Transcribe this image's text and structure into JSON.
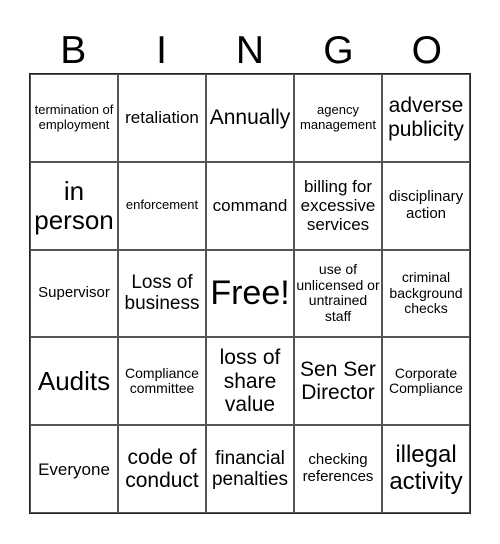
{
  "header": {
    "letters": [
      "B",
      "I",
      "N",
      "G",
      "O"
    ]
  },
  "cells": [
    [
      "termination of employment",
      "retaliation",
      "Annually",
      "agency management",
      "adverse publicity"
    ],
    [
      "in person",
      "enforcement",
      "command",
      "billing for excessive services",
      "disciplinary action"
    ],
    [
      "Supervisor",
      "Loss of business",
      "Free!",
      "use of unlicensed or untrained staff",
      "criminal background checks"
    ],
    [
      "Audits",
      "Compliance committee",
      "loss of share value",
      "Sen Ser Director",
      "Corporate Compliance"
    ],
    [
      "Everyone",
      "code of conduct",
      "financial penalties",
      "checking references",
      "illegal activity"
    ]
  ]
}
